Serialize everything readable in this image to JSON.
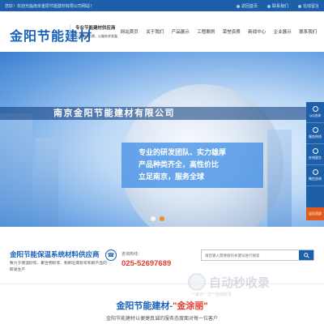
{
  "topbar": {
    "welcome": "您好！欢迎光临南京金阳节能建材有限公司网站！",
    "links": [
      "返回首页",
      "联系我们",
      "在线留言"
    ]
  },
  "header": {
    "logo": "金阳节能建材",
    "slogan_main": "专业节能建材供应商",
    "slogan_sub": "以品质树品牌，以服务求发展"
  },
  "nav": {
    "items": [
      {
        "label": "网站首页",
        "active": true
      },
      {
        "label": "关于我们",
        "active": false
      },
      {
        "label": "产品展示",
        "active": false
      },
      {
        "label": "工程案例",
        "active": false
      },
      {
        "label": "荣誉资质",
        "active": false
      },
      {
        "label": "新闻中心",
        "active": false
      },
      {
        "label": "企业展示",
        "active": false
      },
      {
        "label": "联系我们",
        "active": false
      }
    ]
  },
  "banner": {
    "title": "南京金阳节能建材有限公司",
    "tags": [
      "专业的研发团队、实力雄厚",
      "产品种类齐全，高性价比",
      "立足南京，服务全球"
    ],
    "slide_count": 2,
    "active_slide": 2
  },
  "side_panel": {
    "items": [
      "QQ咨询",
      "服务热线",
      "在线留言",
      "微信咨询"
    ],
    "top": "返回顶部"
  },
  "info": {
    "title": "金阳节能保温系统材料供应商",
    "description": "致力于保温砂浆、聚合物砂浆、粉刷石膏砂浆和新产品的研发生产",
    "hotline_label": "咨询热线：",
    "hotline_number": "025-52697689",
    "search_placeholder": "请您输入需要搜的关键词进行搜索",
    "hot_tags": ""
  },
  "brand": {
    "part1": "金阳节能建材-",
    "part2": "\"金涂丽\"",
    "subtitle": "金阳节能建材以便捷真诚的服务态度面对每一位客户"
  },
  "watermark": {
    "text": "自动秒收录",
    "sub": "一来访一次一自动收录"
  },
  "colors": {
    "primary": "#1d5fa8",
    "accent": "#e33b2c",
    "active_dot": "#f28a1e"
  }
}
